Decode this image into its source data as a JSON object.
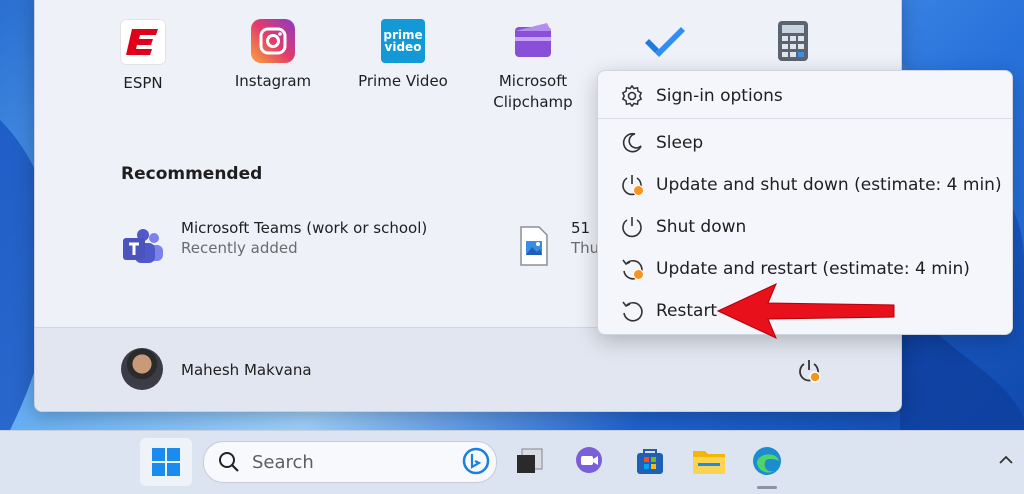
{
  "pinned_apps": [
    {
      "label": "ESPN",
      "icon": "espn-icon"
    },
    {
      "label": "Instagram",
      "icon": "instagram-icon"
    },
    {
      "label": "Prime Video",
      "icon": "prime-video-icon",
      "icon_text_line1": "prime",
      "icon_text_line2": "video"
    },
    {
      "label_line1": "Microsoft",
      "label_line2": "Clipchamp",
      "icon": "clipchamp-icon"
    },
    {
      "label": "",
      "icon": "todo-icon"
    },
    {
      "label": "",
      "icon": "calculator-icon"
    }
  ],
  "recommended": {
    "title": "Recommended",
    "items": [
      {
        "title": "Microsoft Teams (work or school)",
        "subtitle": "Recently added",
        "icon": "teams-icon"
      },
      {
        "title": "51",
        "subtitle": "Thu",
        "icon": "image-file-icon"
      }
    ]
  },
  "user": {
    "name": "Mahesh Makvana"
  },
  "power_menu": {
    "items": [
      {
        "label": "Sign-in options",
        "icon": "gear-icon"
      },
      {
        "label": "Sleep",
        "icon": "moon-icon"
      },
      {
        "label": "Update and shut down (estimate: 4 min)",
        "icon": "power-update-icon"
      },
      {
        "label": "Shut down",
        "icon": "power-icon"
      },
      {
        "label": "Update and restart (estimate: 4 min)",
        "icon": "restart-update-icon"
      },
      {
        "label": "Restart",
        "icon": "restart-icon"
      }
    ]
  },
  "taskbar": {
    "search_placeholder": "Search"
  },
  "colors": {
    "accent_arrow": "#e8101a",
    "update_dot": "#f7941d",
    "menu_bg": "#eef1f8"
  }
}
